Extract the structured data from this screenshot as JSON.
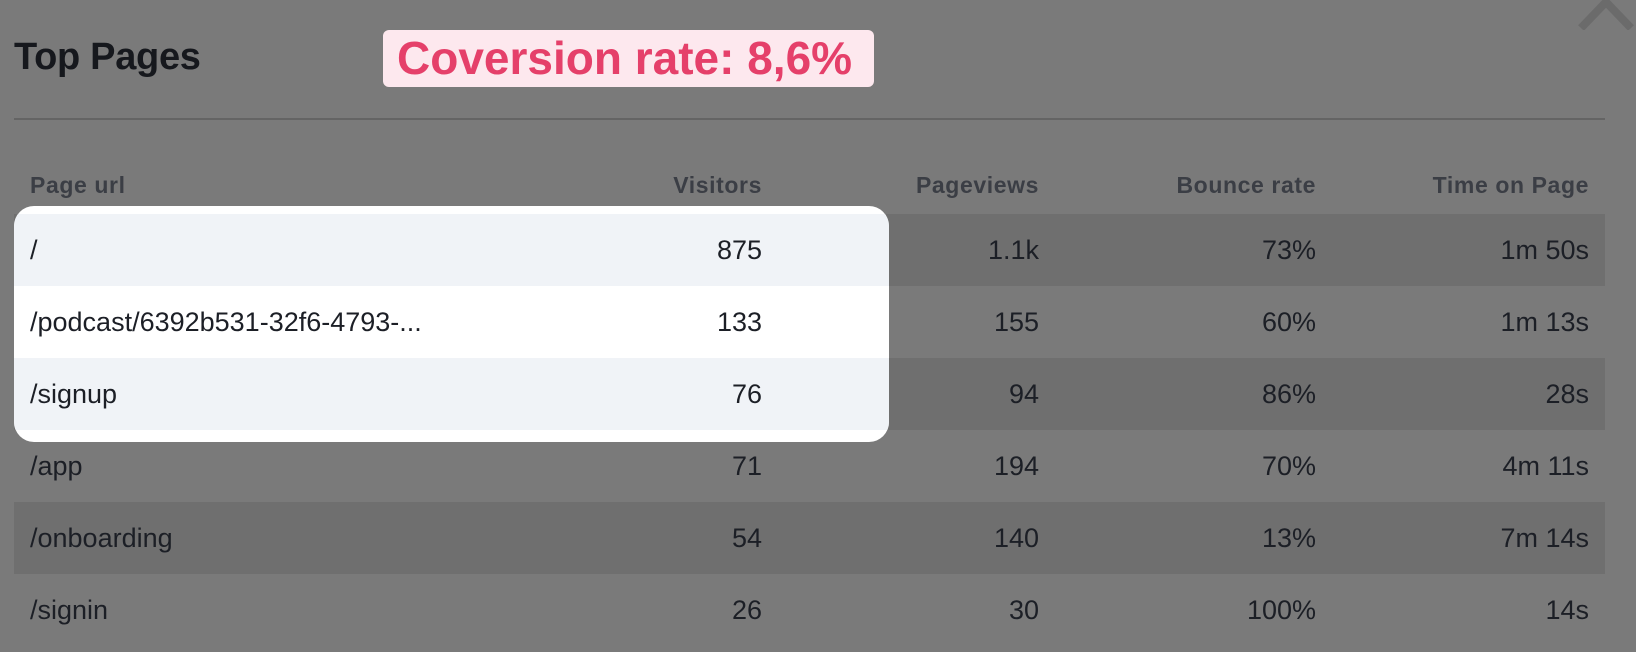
{
  "modal": {
    "title": "Top Pages",
    "badge": "Coversion rate: 8,6%",
    "close_icon": "close-icon"
  },
  "columns": {
    "url": "Page url",
    "visitors": "Visitors",
    "pageviews": "Pageviews",
    "bounce": "Bounce rate",
    "time": "Time on Page"
  },
  "rows": [
    {
      "url": "/",
      "visitors": "875",
      "pageviews": "1.1k",
      "bounce": "73%",
      "time": "1m 50s"
    },
    {
      "url": "/podcast/6392b531-32f6-4793-...",
      "visitors": "133",
      "pageviews": "155",
      "bounce": "60%",
      "time": "1m 13s"
    },
    {
      "url": "/signup",
      "visitors": "76",
      "pageviews": "94",
      "bounce": "86%",
      "time": "28s"
    },
    {
      "url": "/app",
      "visitors": "71",
      "pageviews": "194",
      "bounce": "70%",
      "time": "4m 11s"
    },
    {
      "url": "/onboarding",
      "visitors": "54",
      "pageviews": "140",
      "bounce": "13%",
      "time": "7m 14s"
    },
    {
      "url": "/signin",
      "visitors": "26",
      "pageviews": "30",
      "bounce": "100%",
      "time": "14s"
    }
  ],
  "colors": {
    "overlay": "#7a7a7a",
    "stripe": "#6f6f6f",
    "badge_bg": "#fde8ee",
    "badge_text": "#e5406a",
    "highlight_bg": "#ffffff",
    "highlight_alt": "#f0f3f7"
  }
}
